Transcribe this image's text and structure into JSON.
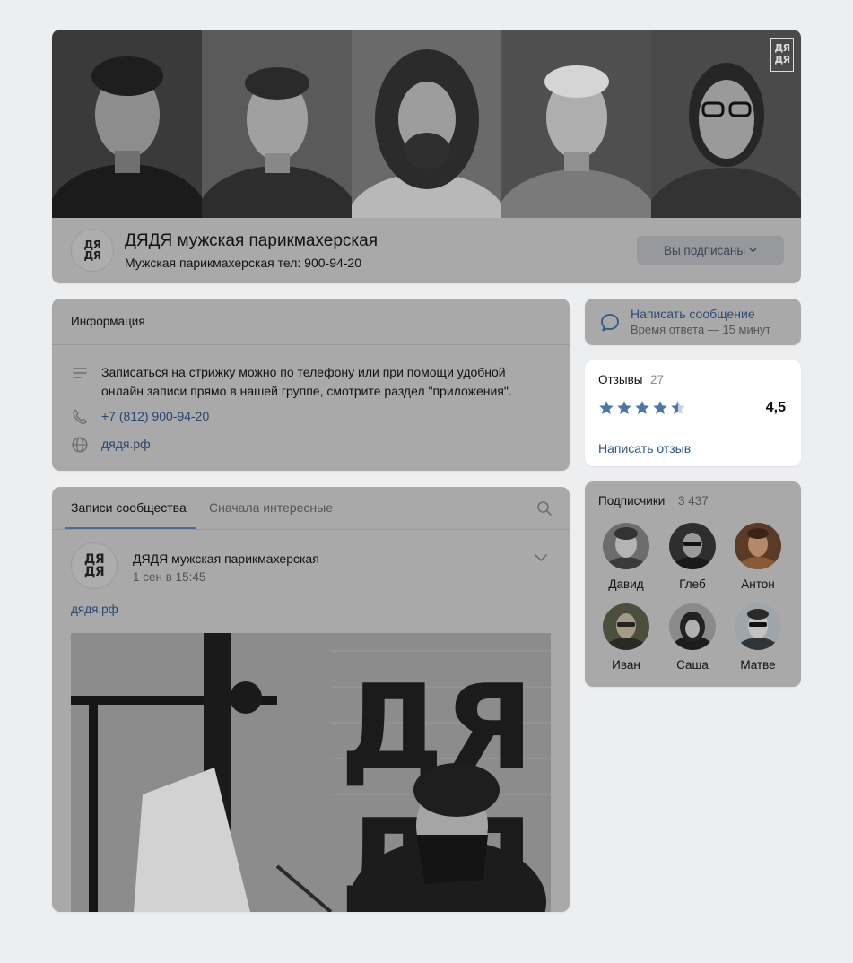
{
  "header": {
    "cover_logo_lines": [
      "ДЯ",
      "ДЯ"
    ],
    "avatar_lines": [
      "ДЯ",
      "ДЯ"
    ],
    "group_name": "ДЯДЯ мужская парикмахерская",
    "status": "Мужская парикмахерская тел: 900-94-20",
    "subscribed_button": "Вы подписаны",
    "subscribed_chevron": "⌄"
  },
  "info": {
    "title": "Информация",
    "description": "Записаться на стрижку можно по телефону или при помощи удобной онлайн записи прямо в нашей группе, смотрите раздел \"приложения\".",
    "phone": "+7 (812) 900-94-20",
    "website": "дядя.рф",
    "icons": [
      "text-lines-icon",
      "phone-icon",
      "globe-icon"
    ]
  },
  "message": {
    "title": "Написать сообщение",
    "subtitle": "Время ответа — 15 минут",
    "icon": "chat-bubble-icon"
  },
  "reviews": {
    "title": "Отзывы",
    "count": "27",
    "rating": "4,5",
    "stars": 4.5,
    "write_link": "Написать отзыв",
    "star_color": "#4a76a8"
  },
  "subscribers": {
    "title": "Подписчики",
    "count": "3 437",
    "people": [
      {
        "name": "Давид"
      },
      {
        "name": "Глеб"
      },
      {
        "name": "Антон"
      },
      {
        "name": "Иван"
      },
      {
        "name": "Саша"
      },
      {
        "name": "Матве"
      }
    ]
  },
  "wall": {
    "tabs": [
      {
        "label": "Записи сообщества",
        "active": true
      },
      {
        "label": "Сначала интересные",
        "active": false
      }
    ],
    "post": {
      "avatar_lines": [
        "ДЯ",
        "ДЯ"
      ],
      "author": "ДЯДЯ мужская парикмахерская",
      "date": "1 сен в 15:45",
      "link": "дядя.рф",
      "image_sign_lines": [
        "ДЯ",
        "ДЯ"
      ]
    }
  },
  "colors": {
    "page_bg": "#edeef0",
    "dimmed_card": "#a9a9a9",
    "link": "#2a5885",
    "accent": "#4a76a8"
  }
}
